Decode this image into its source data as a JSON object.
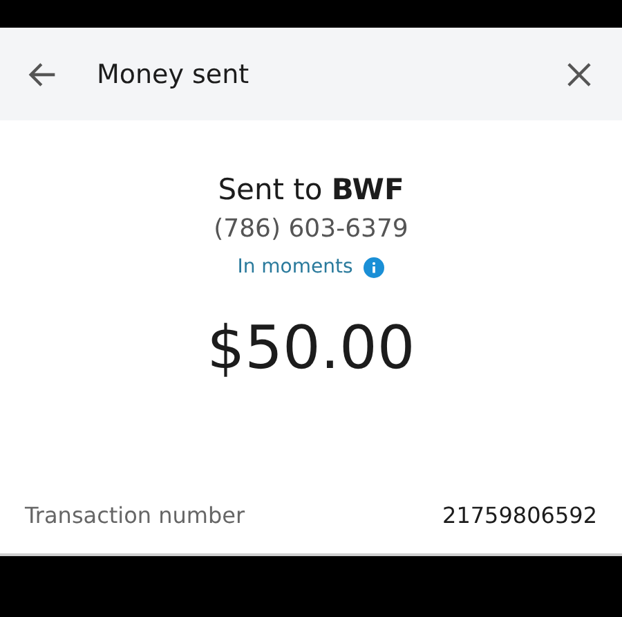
{
  "header": {
    "title": "Money sent"
  },
  "recipient": {
    "line": "Sent to **BWF**",
    "phone": "(786) 603-6379",
    "timing": "In moments"
  },
  "amount": "$50.00",
  "details": [
    {
      "label": "Transaction number",
      "value": "21759806592"
    }
  ]
}
